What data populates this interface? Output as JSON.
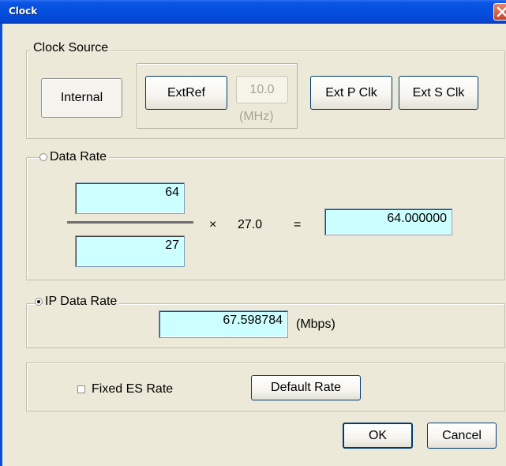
{
  "window": {
    "title": "Clock"
  },
  "clock_source": {
    "legend": "Clock Source",
    "internal_label": "Internal",
    "extref_label": "ExtRef",
    "mhz_value": "10.0",
    "mhz_unit": "(MHz)",
    "ext_p_clk_label": "Ext P Clk",
    "ext_s_clk_label": "Ext S Clk",
    "selected": "Internal"
  },
  "data_rate": {
    "legend": "Data Rate",
    "selected": false,
    "numerator": "64",
    "denominator": "27",
    "multiply_sign": "×",
    "factor": "27.0",
    "equals_sign": "=",
    "result": "64.000000"
  },
  "ip_data_rate": {
    "legend": "IP Data Rate",
    "selected": true,
    "value": "67.598784",
    "unit": "(Mbps)"
  },
  "options": {
    "fixed_es_rate_label": "Fixed ES Rate",
    "fixed_es_rate_checked": false,
    "default_rate_label": "Default Rate"
  },
  "footer": {
    "ok_label": "OK",
    "cancel_label": "Cancel"
  },
  "colors": {
    "titlebar": "#0450de",
    "field_bg": "#ccffff",
    "dialog_bg": "#ece9d8"
  }
}
